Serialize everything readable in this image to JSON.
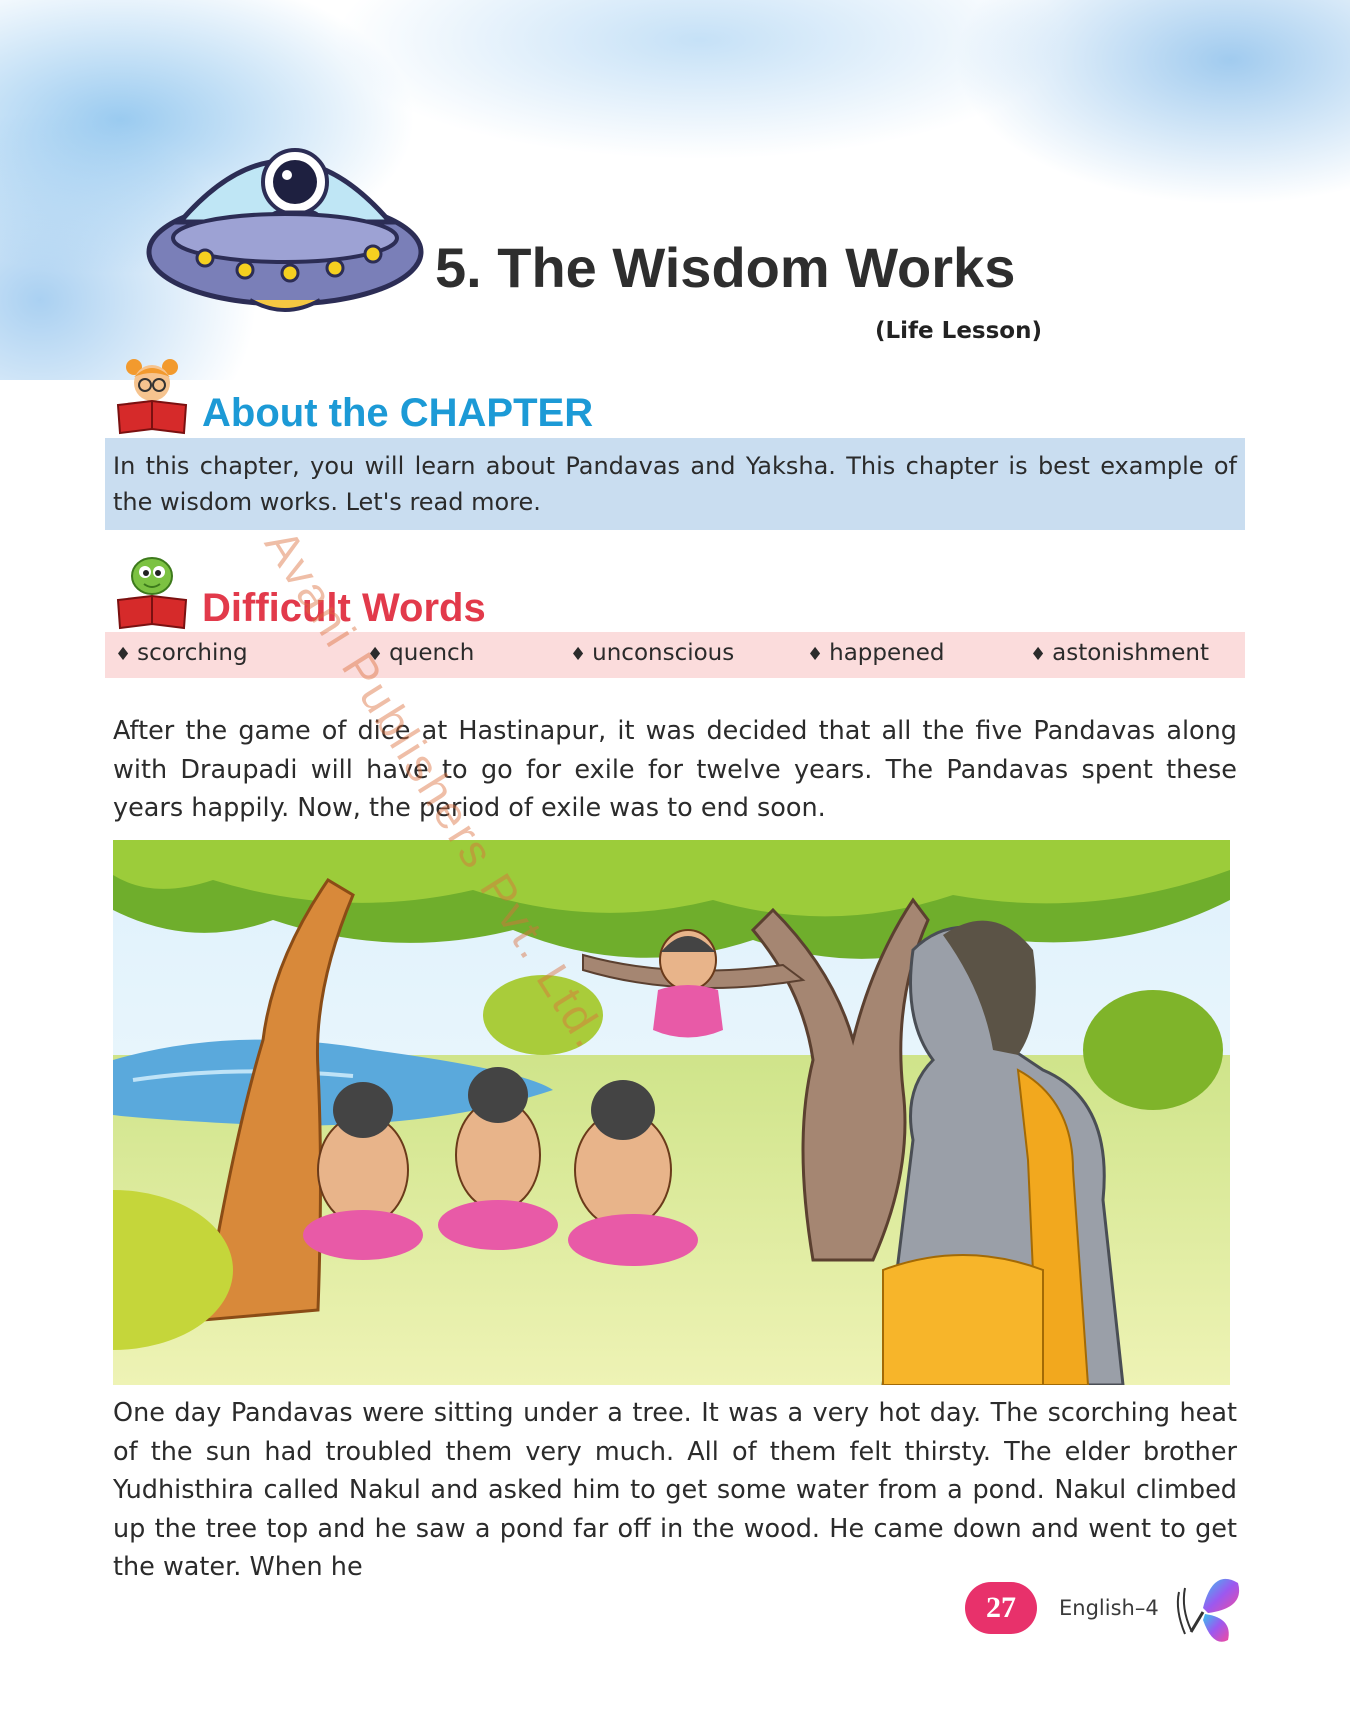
{
  "header": {
    "title": "5. The Wisdom Works",
    "subtitle": "(Life Lesson)"
  },
  "about": {
    "heading": "About the CHAPTER",
    "text": "In this chapter, you will learn about Pandavas and Yaksha. This chapter is best example of the wisdom works. Let's read more."
  },
  "difficult_words": {
    "heading": "Difficult Words",
    "items": [
      "scorching",
      "quench",
      "unconscious",
      "happened",
      "astonishment"
    ]
  },
  "story": {
    "paragraph1": "After the game of dice at Hastinapur, it was decided that all the five Pandavas along with Draupadi will have to go for exile for twelve years. The Pandavas spent these years happily. Now, the period of exile was to end soon.",
    "paragraph2": "One day Pandavas were sitting under a tree. It was a very hot day. The scorching heat of the sun had troubled them very much. All of them felt thirsty. The elder brother Yudhisthira called Nakul and asked him to get some water from a pond. Nakul climbed up the tree top and he saw a pond far off in the wood. He came down and went to get the water. When he"
  },
  "watermark": "Avani Publishers Pvt. Ltd.",
  "footer": {
    "page_number": "27",
    "book": "English–4"
  },
  "colors": {
    "about_heading": "#1c9ad6",
    "words_heading": "#e23a4b",
    "about_box": "#c9ddf0",
    "words_strip": "#fbdcdc",
    "page_badge": "#e8316b"
  },
  "icons": {
    "header": "ufo-astronaut-icon",
    "about": "girl-reading-book-icon",
    "words": "worm-reading-book-icon",
    "footer": "butterfly-icon"
  }
}
